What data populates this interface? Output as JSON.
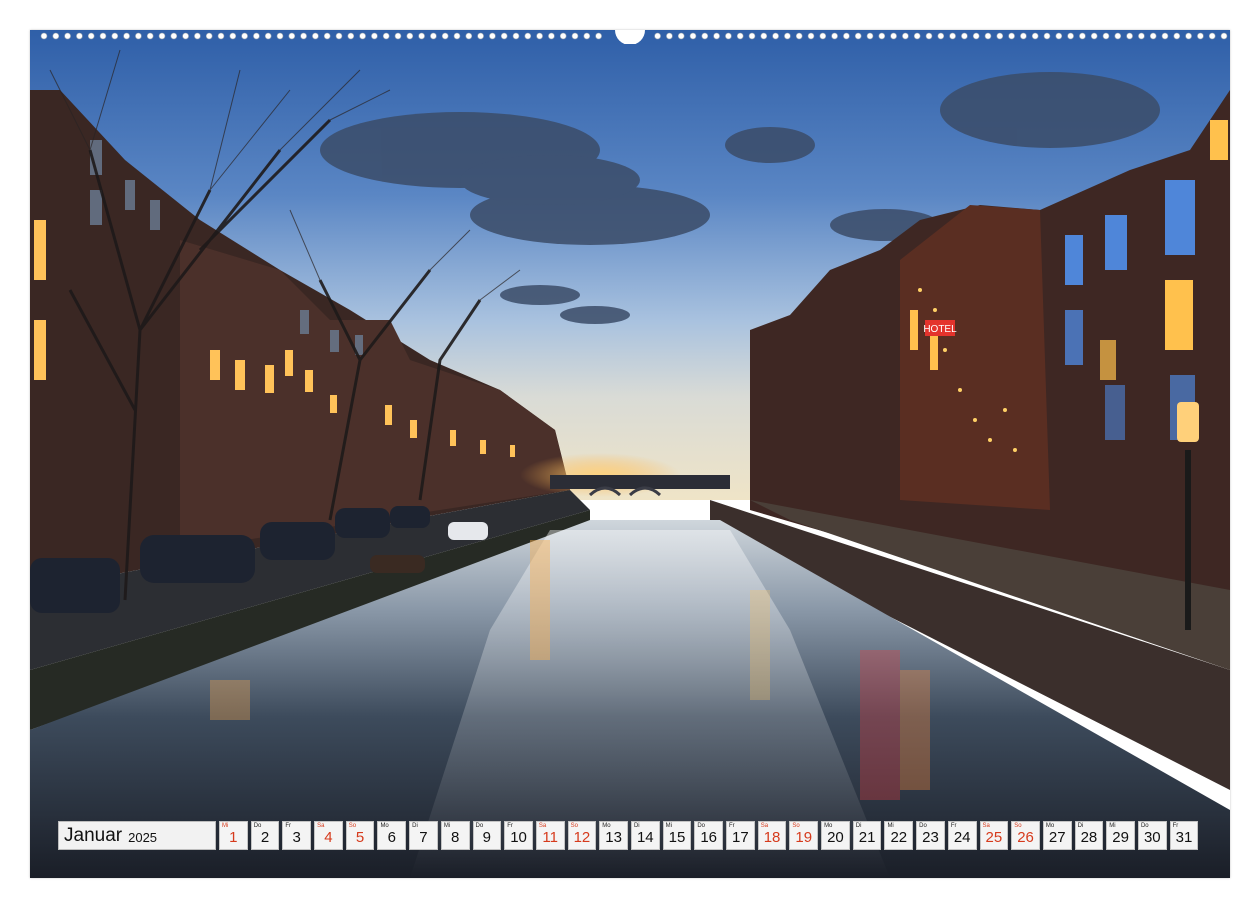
{
  "calendar": {
    "month": "Januar",
    "year": "2025",
    "weekend_color": "#d63a1c",
    "days": [
      {
        "wd": "Mi",
        "num": "1",
        "red": true
      },
      {
        "wd": "Do",
        "num": "2",
        "red": false
      },
      {
        "wd": "Fr",
        "num": "3",
        "red": false
      },
      {
        "wd": "Sa",
        "num": "4",
        "red": true
      },
      {
        "wd": "So",
        "num": "5",
        "red": true
      },
      {
        "wd": "Mo",
        "num": "6",
        "red": false
      },
      {
        "wd": "Di",
        "num": "7",
        "red": false
      },
      {
        "wd": "Mi",
        "num": "8",
        "red": false
      },
      {
        "wd": "Do",
        "num": "9",
        "red": false
      },
      {
        "wd": "Fr",
        "num": "10",
        "red": false
      },
      {
        "wd": "Sa",
        "num": "11",
        "red": true
      },
      {
        "wd": "So",
        "num": "12",
        "red": true
      },
      {
        "wd": "Mo",
        "num": "13",
        "red": false
      },
      {
        "wd": "Di",
        "num": "14",
        "red": false
      },
      {
        "wd": "Mi",
        "num": "15",
        "red": false
      },
      {
        "wd": "Do",
        "num": "16",
        "red": false
      },
      {
        "wd": "Fr",
        "num": "17",
        "red": false
      },
      {
        "wd": "Sa",
        "num": "18",
        "red": true
      },
      {
        "wd": "So",
        "num": "19",
        "red": true
      },
      {
        "wd": "Mo",
        "num": "20",
        "red": false
      },
      {
        "wd": "Di",
        "num": "21",
        "red": false
      },
      {
        "wd": "Mi",
        "num": "22",
        "red": false
      },
      {
        "wd": "Do",
        "num": "23",
        "red": false
      },
      {
        "wd": "Fr",
        "num": "24",
        "red": false
      },
      {
        "wd": "Sa",
        "num": "25",
        "red": true
      },
      {
        "wd": "So",
        "num": "26",
        "red": true
      },
      {
        "wd": "Mo",
        "num": "27",
        "red": false
      },
      {
        "wd": "Di",
        "num": "28",
        "red": false
      },
      {
        "wd": "Mi",
        "num": "29",
        "red": false
      },
      {
        "wd": "Do",
        "num": "30",
        "red": false
      },
      {
        "wd": "Fr",
        "num": "31",
        "red": false
      }
    ]
  },
  "photo": {
    "sign_text": "HOTEL"
  }
}
